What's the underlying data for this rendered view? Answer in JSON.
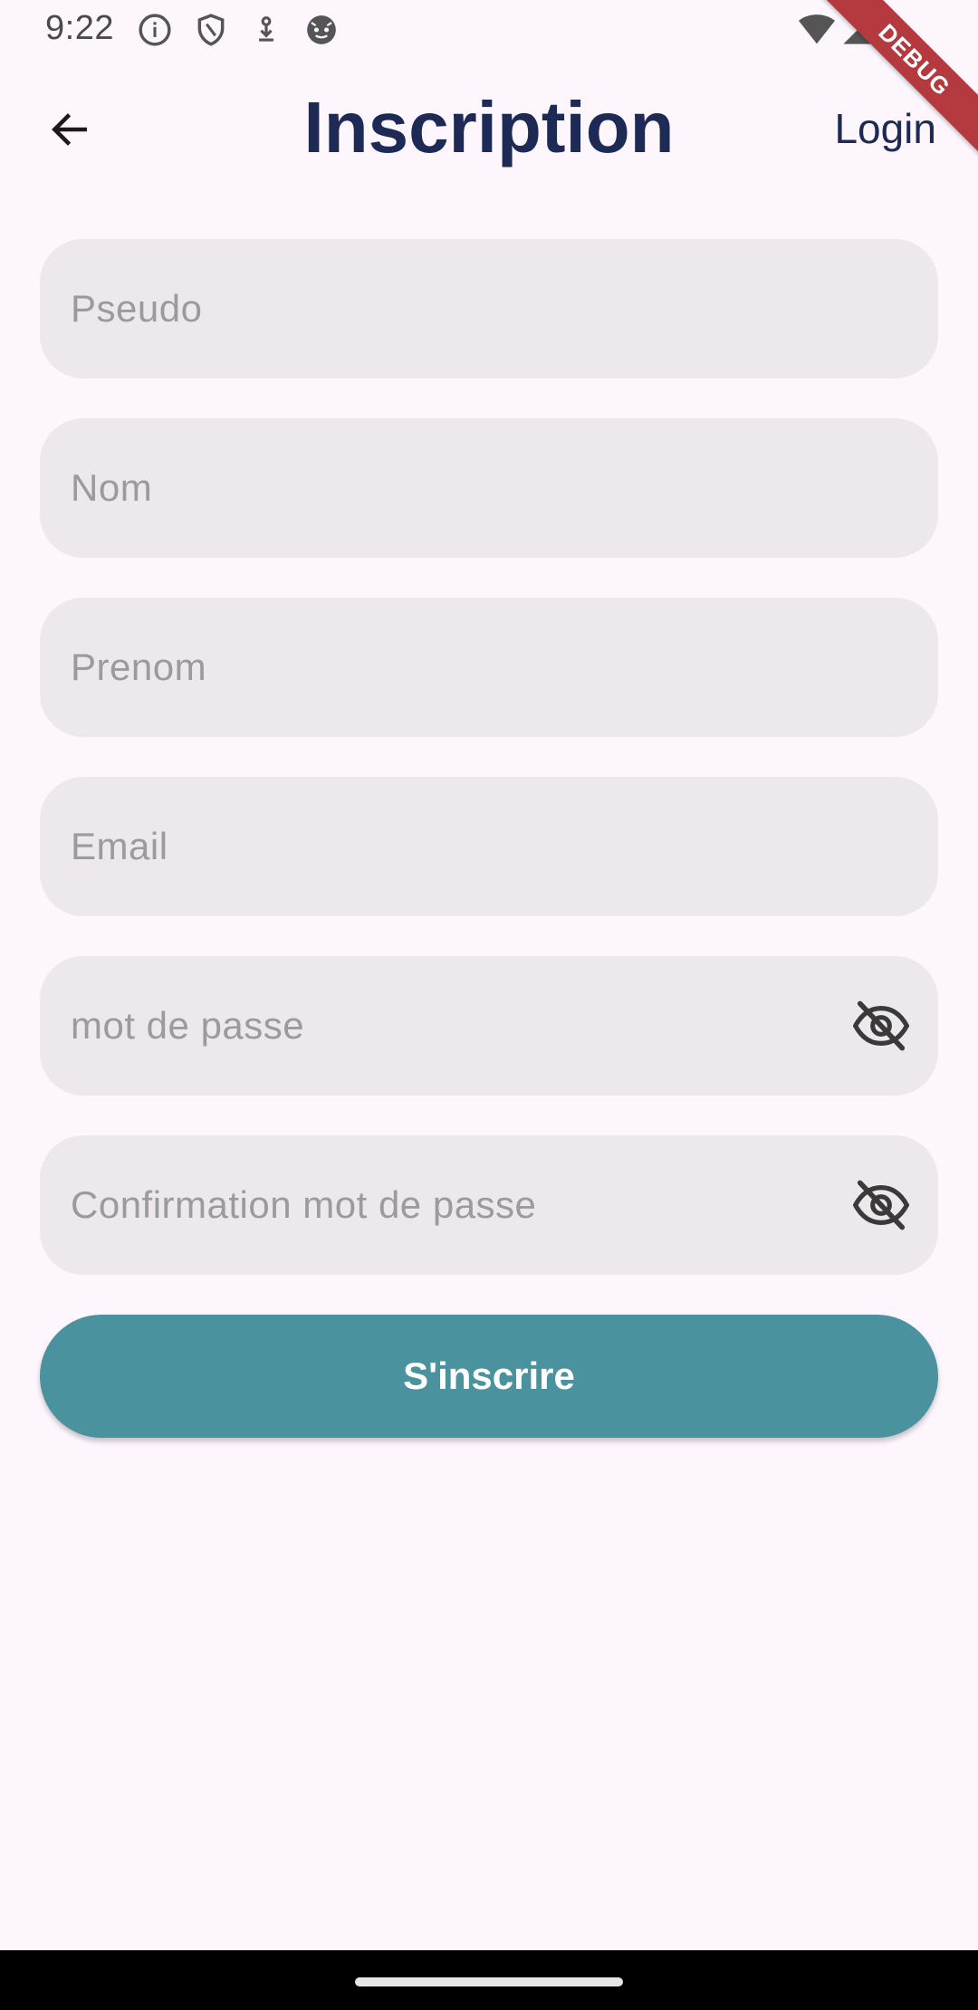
{
  "status_bar": {
    "time": "9:22",
    "icons": [
      "info-icon",
      "shield-icon",
      "download-icon",
      "cat-face-icon",
      "wifi-icon",
      "cell-signal-icon"
    ]
  },
  "debug_banner": {
    "label": "DEBUG",
    "color": "#b43a3f"
  },
  "app_bar": {
    "back_icon": "arrow-back-icon",
    "title": "Inscription",
    "login_label": "Login"
  },
  "form": {
    "fields": [
      {
        "placeholder": "Pseudo",
        "value": "",
        "type": "text"
      },
      {
        "placeholder": "Nom",
        "value": "",
        "type": "text"
      },
      {
        "placeholder": "Prenom",
        "value": "",
        "type": "text"
      },
      {
        "placeholder": "Email",
        "value": "",
        "type": "email"
      },
      {
        "placeholder": "mot de passe",
        "value": "",
        "type": "password",
        "toggle_icon": "eye-off-icon"
      },
      {
        "placeholder": "Confirmation mot de passe",
        "value": "",
        "type": "password",
        "toggle_icon": "eye-off-icon"
      }
    ],
    "submit_label": "S'inscrire"
  },
  "colors": {
    "background": "#fdf6fd",
    "title": "#1c2a55",
    "field_fill": "#ece8ec",
    "placeholder": "#9b9a9c",
    "button": "#4a929e",
    "button_text": "#ffffff"
  }
}
